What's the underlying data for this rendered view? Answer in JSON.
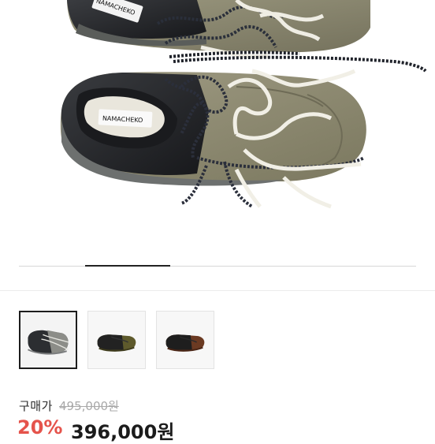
{
  "product": {
    "brand_label": "NAMACHEKO",
    "image_count": 3,
    "selected_image_index": 1
  },
  "thumbnails": [
    {
      "name": "grey-black",
      "selected": true
    },
    {
      "name": "olive-black",
      "selected": false
    },
    {
      "name": "brown-black",
      "selected": false
    }
  ],
  "pricing": {
    "label": "구매가",
    "original_price": "495,000원",
    "discount": "20%",
    "sale_price": "396,000원"
  },
  "colors": {
    "discount": "#e5534b",
    "suede": "#8a8770",
    "leather": "#222428"
  }
}
